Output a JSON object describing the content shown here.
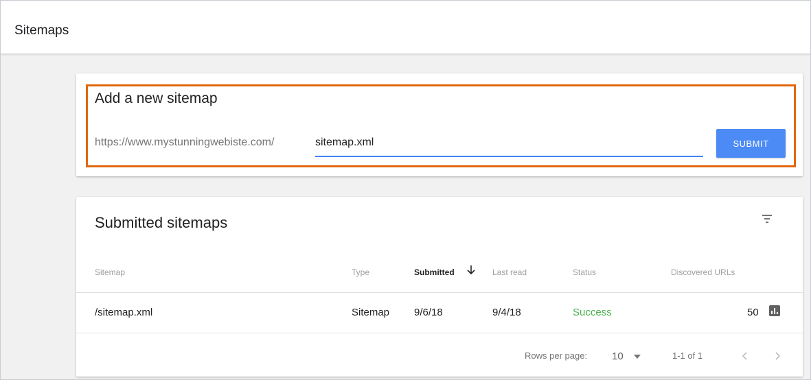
{
  "header": {
    "title": "Sitemaps"
  },
  "add_sitemap": {
    "title": "Add a new sitemap",
    "url_prefix": "https://www.mystunningwebiste.com/",
    "input_value": "sitemap.xml",
    "submit_label": "SUBMIT",
    "accent_color": "#4285f4",
    "highlight_color": "#e2660d"
  },
  "submitted": {
    "title": "Submitted sitemaps",
    "filter_icon": "filter-icon",
    "columns": [
      "Sitemap",
      "Type",
      "Submitted",
      "Last read",
      "Status",
      "Discovered URLs"
    ],
    "sorted_column": "Submitted",
    "sort_direction": "descending",
    "rows": [
      {
        "sitemap": "/sitemap.xml",
        "type": "Sitemap",
        "submitted": "9/6/18",
        "last_read": "9/4/18",
        "status": "Success",
        "discovered_urls": "50",
        "status_color": "#4caf50",
        "action_icon": "bar-chart-icon"
      }
    ],
    "footer": {
      "rows_per_page_label": "Rows per page:",
      "rows_per_page_value": "10",
      "range": "1-1 of 1"
    }
  }
}
